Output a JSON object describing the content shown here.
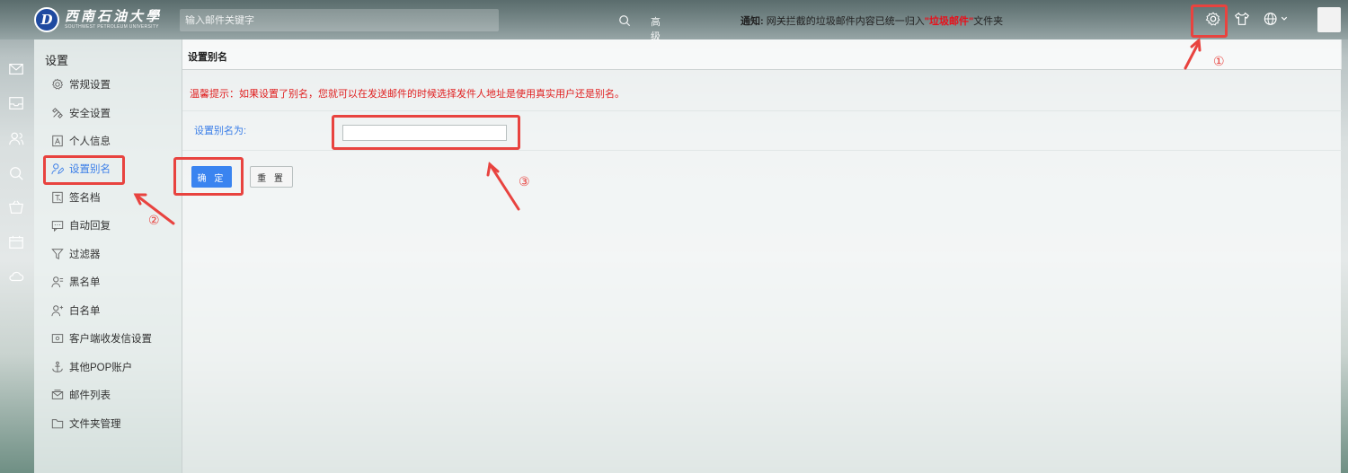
{
  "header": {
    "logo_cn": "西南石油大學",
    "logo_en": "SOUTHWEST PETROLEUM UNIVERSITY",
    "search_placeholder": "输入邮件关键字",
    "search_advanced": "高级",
    "notice_label": "通知:",
    "notice_text": "网关拦截的垃圾邮件内容已统一归入",
    "notice_highlight": "\"垃圾邮件\"",
    "notice_suffix": "文件夹"
  },
  "sidebar": {
    "title": "设置",
    "items": [
      {
        "label": "常规设置",
        "icon": "gear-icon"
      },
      {
        "label": "安全设置",
        "icon": "tools-icon"
      },
      {
        "label": "个人信息",
        "icon": "id-card-icon"
      },
      {
        "label": "设置别名",
        "icon": "user-edit-icon"
      },
      {
        "label": "签名档",
        "icon": "signature-icon"
      },
      {
        "label": "自动回复",
        "icon": "chat-icon"
      },
      {
        "label": "过滤器",
        "icon": "filter-icon"
      },
      {
        "label": "黑名单",
        "icon": "user-block-icon"
      },
      {
        "label": "白名单",
        "icon": "user-allow-icon"
      },
      {
        "label": "客户端收发信设置",
        "icon": "client-icon"
      },
      {
        "label": "其他POP账户",
        "icon": "anchor-icon"
      },
      {
        "label": "邮件列表",
        "icon": "mail-list-icon"
      },
      {
        "label": "文件夹管理",
        "icon": "folder-icon"
      }
    ],
    "active_index": 3
  },
  "main": {
    "title": "设置别名",
    "tip": "温馨提示：如果设置了别名，您就可以在发送邮件的时候选择发件人地址是使用真实用户还是别名。",
    "alias_label": "设置别名为:",
    "alias_value": "",
    "ok_label": "确 定",
    "reset_label": "重 置"
  },
  "annotations": {
    "one": "①",
    "two": "②",
    "three": "③"
  },
  "colors": {
    "accent": "#3a84f0",
    "annotation": "#e8433f",
    "tip": "#e02020"
  }
}
